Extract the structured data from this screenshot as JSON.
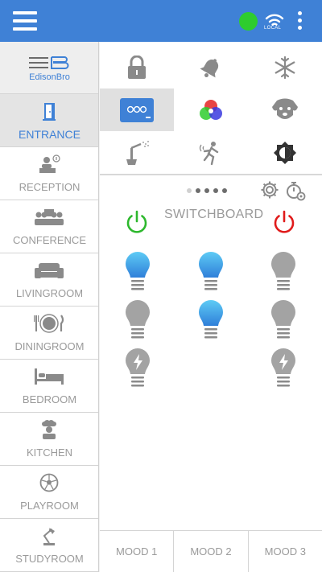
{
  "topbar": {
    "menu_icon": "hamburger-menu-icon",
    "status_color": "#2ecc2e",
    "connection_label": "LOCAL",
    "more_icon": "vertical-ellipsis-icon",
    "accent": "#3f81d6"
  },
  "sidebar": {
    "logo_text": "EdisonBro",
    "items": [
      {
        "label": "ENTRANCE",
        "icon": "door-icon",
        "active": true
      },
      {
        "label": "RECEPTION",
        "icon": "reception-desk-icon"
      },
      {
        "label": "CONFERENCE",
        "icon": "conference-people-icon"
      },
      {
        "label": "LIVINGROOM",
        "icon": "sofa-icon"
      },
      {
        "label": "DININGROOM",
        "icon": "plate-cutlery-icon"
      },
      {
        "label": "BEDROOM",
        "icon": "bed-icon"
      },
      {
        "label": "KITCHEN",
        "icon": "chef-icon"
      },
      {
        "label": "PLAYROOM",
        "icon": "soccer-ball-icon"
      },
      {
        "label": "STUDYROOM",
        "icon": "desk-lamp-icon"
      }
    ]
  },
  "devices": [
    {
      "icon": "lock-icon"
    },
    {
      "icon": "bell-icon"
    },
    {
      "icon": "snowflake-icon"
    },
    {
      "icon": "switch-panel-icon",
      "selected": true
    },
    {
      "icon": "rgb-light-icon"
    },
    {
      "icon": "dog-icon"
    },
    {
      "icon": "sprinkler-icon"
    },
    {
      "icon": "motion-sensor-icon"
    },
    {
      "icon": "brightness-icon"
    }
  ],
  "switchboard": {
    "title": "SWITCHBOARD",
    "pager": {
      "pages": 5,
      "current": 1
    },
    "on_color": "#2db82d",
    "off_color": "#e01b1b",
    "bulb_on_color": "#3fa3e6",
    "bulb_off_color": "#a3a3a3",
    "bulbs": [
      {
        "type": "bulb",
        "state": "on"
      },
      {
        "type": "bulb",
        "state": "on"
      },
      {
        "type": "bulb",
        "state": "off"
      },
      {
        "type": "bulb",
        "state": "off"
      },
      {
        "type": "bulb",
        "state": "on"
      },
      {
        "type": "bulb",
        "state": "off"
      },
      {
        "type": "power-bulb",
        "state": "off"
      },
      {
        "type": "power-bulb",
        "state": "off"
      }
    ]
  },
  "moods": [
    "MOOD 1",
    "MOOD 2",
    "MOOD 3"
  ]
}
